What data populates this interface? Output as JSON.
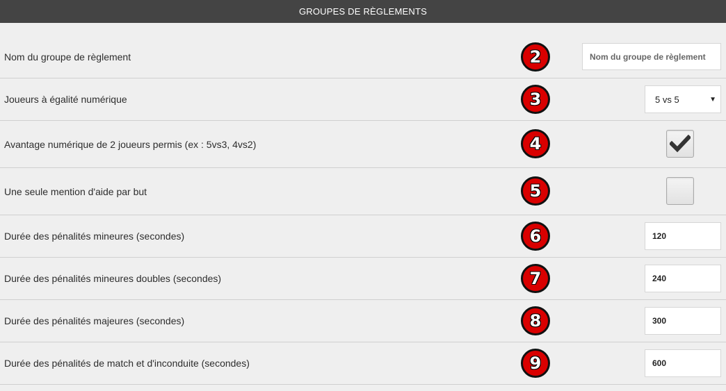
{
  "header": {
    "title": "GROUPES DE RÈGLEMENTS"
  },
  "rows": [
    {
      "label": "Nom du groupe de règlement",
      "badge": "2",
      "control": {
        "type": "text",
        "value": "",
        "placeholder": "Nom du groupe de règlement"
      }
    },
    {
      "label": "Joueurs à égalité numérique",
      "badge": "3",
      "control": {
        "type": "select",
        "value": "5 vs 5"
      }
    },
    {
      "label": "Avantage numérique de 2 joueurs permis (ex : 5vs3, 4vs2)",
      "badge": "4",
      "control": {
        "type": "checkbox",
        "checked": true
      }
    },
    {
      "label": "Une seule mention d'aide par but",
      "badge": "5",
      "control": {
        "type": "checkbox",
        "checked": false
      }
    },
    {
      "label": "Durée des pénalités mineures (secondes)",
      "badge": "6",
      "control": {
        "type": "number",
        "value": "120"
      }
    },
    {
      "label": "Durée des pénalités mineures doubles (secondes)",
      "badge": "7",
      "control": {
        "type": "number",
        "value": "240"
      }
    },
    {
      "label": "Durée des pénalités majeures (secondes)",
      "badge": "8",
      "control": {
        "type": "number",
        "value": "300"
      }
    },
    {
      "label": "Durée des pénalités de match et d'inconduite (secondes)",
      "badge": "9",
      "control": {
        "type": "number",
        "value": "600"
      }
    }
  ],
  "colors": {
    "header_bg": "#444444",
    "page_bg": "#efefef",
    "badge_red": "#d90000"
  }
}
